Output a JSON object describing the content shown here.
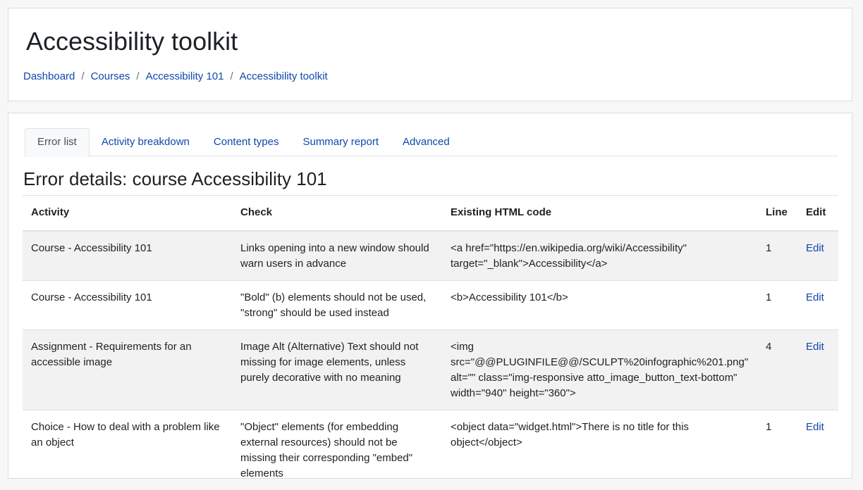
{
  "header": {
    "title": "Accessibility toolkit",
    "breadcrumb": [
      {
        "label": "Dashboard"
      },
      {
        "label": "Courses"
      },
      {
        "label": "Accessibility 101"
      },
      {
        "label": "Accessibility toolkit"
      }
    ],
    "separator": "/"
  },
  "tabs": [
    {
      "label": "Error list",
      "active": true
    },
    {
      "label": "Activity breakdown",
      "active": false
    },
    {
      "label": "Content types",
      "active": false
    },
    {
      "label": "Summary report",
      "active": false
    },
    {
      "label": "Advanced",
      "active": false
    }
  ],
  "section_title": "Error details: course Accessibility 101",
  "table": {
    "headers": [
      "Activity",
      "Check",
      "Existing HTML code",
      "Line",
      "Edit"
    ],
    "rows": [
      {
        "activity": "Course - Accessibility 101",
        "check": "Links opening into a new window should warn users in advance",
        "html": "<a href=\"https://en.wikipedia.org/wiki/Accessibility\" target=\"_blank\">Accessibility</a>",
        "line": "1",
        "edit": "Edit"
      },
      {
        "activity": "Course - Accessibility 101",
        "check": "\"Bold\" (b) elements should not be used, \"strong\" should be used instead",
        "html": "<b>Accessibility 101</b>",
        "line": "1",
        "edit": "Edit"
      },
      {
        "activity": "Assignment - Requirements for an accessible image",
        "check": "Image Alt (Alternative) Text should not missing for image elements, unless purely decorative with no meaning",
        "html": "<img src=\"@@PLUGINFILE@@/SCULPT%20infographic%201.png\" alt=\"\" class=\"img-responsive atto_image_button_text-bottom\" width=\"940\" height=\"360\">",
        "line": "4",
        "edit": "Edit"
      },
      {
        "activity": "Choice - How to deal with a problem like an object",
        "check": "\"Object\" elements (for embedding external resources) should not be missing their corresponding \"embed\" elements",
        "html": "<object data=\"widget.html\">There is no title for this object</object>",
        "line": "1",
        "edit": "Edit"
      }
    ]
  }
}
